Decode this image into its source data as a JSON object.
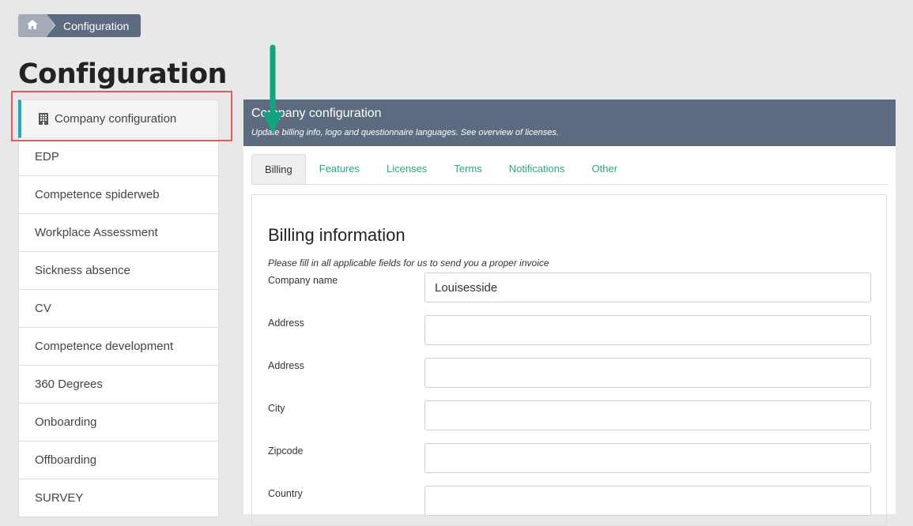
{
  "breadcrumb": {
    "home_icon": "home-icon",
    "current": "Configuration"
  },
  "page": {
    "title": "Configuration"
  },
  "sidebar": {
    "items": [
      {
        "label": "Company configuration",
        "icon": "building-icon",
        "active": true
      },
      {
        "label": "EDP"
      },
      {
        "label": "Competence spiderweb"
      },
      {
        "label": "Workplace Assessment"
      },
      {
        "label": "Sickness absence"
      },
      {
        "label": "CV"
      },
      {
        "label": "Competence development"
      },
      {
        "label": "360 Degrees"
      },
      {
        "label": "Onboarding"
      },
      {
        "label": "Offboarding"
      },
      {
        "label": "SURVEY"
      }
    ]
  },
  "panel": {
    "title": "Company configuration",
    "subtitle": "Update billing info, logo and questionnaire languages. See overview of licenses.",
    "tabs": [
      {
        "label": "Billing",
        "active": true
      },
      {
        "label": "Features"
      },
      {
        "label": "Licenses"
      },
      {
        "label": "Terms"
      },
      {
        "label": "Notifications"
      },
      {
        "label": "Other"
      }
    ]
  },
  "form": {
    "heading": "Billing information",
    "note": "Please fill in all applicable fields for us to send you a proper invoice",
    "fields": [
      {
        "label": "Company name",
        "value": "Louisesside"
      },
      {
        "label": "Address",
        "value": ""
      },
      {
        "label": "Address",
        "value": ""
      },
      {
        "label": "City",
        "value": ""
      },
      {
        "label": "Zipcode",
        "value": ""
      },
      {
        "label": "Country",
        "value": ""
      }
    ]
  },
  "colors": {
    "header_bg": "#5d6b80",
    "accent_teal": "#2ba58a",
    "active_bar": "#1fa9c6",
    "highlight_red": "#e25b5b",
    "arrow_green": "#14a37f"
  }
}
